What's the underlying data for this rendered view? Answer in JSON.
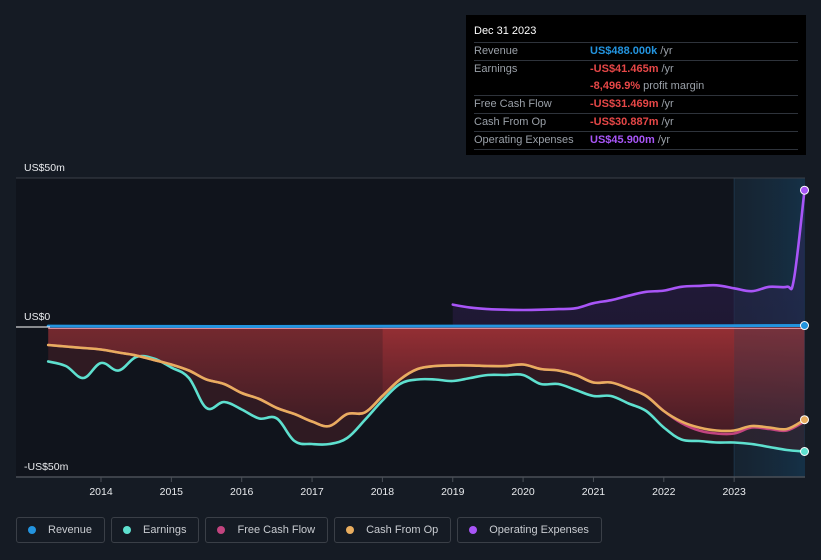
{
  "tooltip": {
    "date": "Dec 31 2023",
    "rows": [
      {
        "label": "Revenue",
        "value": "US$488.000k",
        "unit": "/yr",
        "color": "#2394df"
      },
      {
        "label": "Earnings",
        "value": "-US$41.465m",
        "unit": "/yr",
        "color": "#e64747"
      },
      {
        "label": "",
        "value": "-8,496.9%",
        "unit": "profit margin",
        "color": "#e64747"
      },
      {
        "label": "Free Cash Flow",
        "value": "-US$31.469m",
        "unit": "/yr",
        "color": "#e64747"
      },
      {
        "label": "Cash From Op",
        "value": "-US$30.887m",
        "unit": "/yr",
        "color": "#e64747"
      },
      {
        "label": "Operating Expenses",
        "value": "US$45.900m",
        "unit": "/yr",
        "color": "#a855f7"
      }
    ]
  },
  "legend": [
    {
      "label": "Revenue",
      "color": "#2394df"
    },
    {
      "label": "Earnings",
      "color": "#5ee0cf"
    },
    {
      "label": "Free Cash Flow",
      "color": "#c2447f"
    },
    {
      "label": "Cash From Op",
      "color": "#e8ad5f"
    },
    {
      "label": "Operating Expenses",
      "color": "#a855f7"
    }
  ],
  "chart_data": {
    "type": "line",
    "title": "",
    "xlabel": "",
    "ylabel": "",
    "ylim": [
      -50,
      50
    ],
    "xlim": [
      2013.25,
      2024.0
    ],
    "y_tick_labels": [
      {
        "value": 50,
        "label": "US$50m"
      },
      {
        "value": 0,
        "label": "US$0"
      },
      {
        "value": -50,
        "label": "-US$50m"
      }
    ],
    "x_tick_labels": [
      "2014",
      "2015",
      "2016",
      "2017",
      "2018",
      "2019",
      "2020",
      "2021",
      "2022",
      "2023"
    ],
    "forecast_region_start": 2023.0,
    "legend_position": "bottom",
    "grid": false,
    "series": [
      {
        "name": "Revenue",
        "color": "#2394df",
        "x": [
          2013.25,
          2015,
          2017,
          2019,
          2021,
          2023,
          2024.0
        ],
        "y": [
          0.3,
          0.2,
          0.2,
          0.3,
          0.3,
          0.4,
          0.49
        ]
      },
      {
        "name": "Earnings",
        "color": "#5ee0cf",
        "x": [
          2013.25,
          2013.5,
          2013.75,
          2014.0,
          2014.25,
          2014.5,
          2014.75,
          2015.0,
          2015.25,
          2015.5,
          2015.75,
          2016.0,
          2016.25,
          2016.5,
          2016.75,
          2017.0,
          2017.25,
          2017.5,
          2017.75,
          2018.0,
          2018.25,
          2018.5,
          2018.75,
          2019.0,
          2019.25,
          2019.5,
          2019.75,
          2020.0,
          2020.25,
          2020.5,
          2020.75,
          2021.0,
          2021.25,
          2021.5,
          2021.75,
          2022.0,
          2022.25,
          2022.5,
          2022.75,
          2023.0,
          2023.25,
          2023.5,
          2023.75,
          2024.0
        ],
        "y": [
          -11.5,
          -13,
          -17,
          -12,
          -14.5,
          -10,
          -10.5,
          -13.5,
          -17,
          -27,
          -25,
          -27.5,
          -30.5,
          -30.5,
          -38,
          -39,
          -39,
          -37,
          -31,
          -24.5,
          -19,
          -17.5,
          -17.5,
          -18,
          -17,
          -16,
          -16,
          -16,
          -19,
          -19,
          -21,
          -23,
          -23,
          -25.5,
          -28,
          -33.5,
          -37.5,
          -38,
          -38.5,
          -38.5,
          -39,
          -40,
          -41,
          -41.5
        ]
      },
      {
        "name": "Free Cash Flow",
        "color": "#c2447f",
        "x": [
          2013.25,
          2013.5,
          2013.75,
          2014.0,
          2014.25,
          2014.5,
          2014.75,
          2015.0,
          2015.25,
          2015.5,
          2015.75,
          2016.0,
          2016.25,
          2016.5,
          2016.75,
          2017.0,
          2017.25,
          2017.5,
          2017.75,
          2018.0,
          2018.25,
          2018.5,
          2018.75,
          2019.0,
          2019.25,
          2019.5,
          2019.75,
          2020.0,
          2020.25,
          2020.5,
          2020.75,
          2021.0,
          2021.25,
          2021.5,
          2021.75,
          2022.0,
          2022.25,
          2022.5,
          2022.75,
          2023.0,
          2023.25,
          2023.5,
          2023.75,
          2024.0
        ],
        "y": [
          -6,
          -6.5,
          -7,
          -7.5,
          -8.5,
          -9.5,
          -11,
          -12.5,
          -14.5,
          -17.5,
          -19,
          -22,
          -24,
          -27,
          -29,
          -31.5,
          -33,
          -29,
          -28.5,
          -23,
          -17.5,
          -14,
          -13,
          -12.8,
          -12.8,
          -13,
          -13,
          -12.5,
          -14,
          -14.5,
          -16,
          -18.5,
          -18.5,
          -20.5,
          -23,
          -28,
          -32,
          -34.5,
          -35.5,
          -35.5,
          -33.5,
          -34,
          -34.5,
          -31.5
        ]
      },
      {
        "name": "Cash From Op",
        "color": "#e8ad5f",
        "x": [
          2013.25,
          2013.5,
          2013.75,
          2014.0,
          2014.25,
          2014.5,
          2014.75,
          2015.0,
          2015.25,
          2015.5,
          2015.75,
          2016.0,
          2016.25,
          2016.5,
          2016.75,
          2017.0,
          2017.25,
          2017.5,
          2017.75,
          2018.0,
          2018.25,
          2018.5,
          2018.75,
          2019.0,
          2019.25,
          2019.5,
          2019.75,
          2020.0,
          2020.25,
          2020.5,
          2020.75,
          2021.0,
          2021.25,
          2021.5,
          2021.75,
          2022.0,
          2022.25,
          2022.5,
          2022.75,
          2023.0,
          2023.25,
          2023.5,
          2023.75,
          2024.0
        ],
        "y": [
          -6,
          -6.5,
          -7,
          -7.5,
          -8.5,
          -9.5,
          -11,
          -12.5,
          -14.5,
          -17.5,
          -19,
          -22,
          -24,
          -27,
          -29,
          -31.5,
          -33,
          -29,
          -28.5,
          -23,
          -17.5,
          -14,
          -13,
          -12.8,
          -12.8,
          -13,
          -13,
          -12.5,
          -14,
          -14.5,
          -16,
          -18.5,
          -18.5,
          -20.5,
          -23,
          -28,
          -31.5,
          -33.5,
          -34.5,
          -34.5,
          -33,
          -33.5,
          -34,
          -30.9
        ]
      },
      {
        "name": "Operating Expenses",
        "color": "#a855f7",
        "x": [
          2019.0,
          2019.25,
          2019.5,
          2019.75,
          2020.0,
          2020.25,
          2020.5,
          2020.75,
          2021.0,
          2021.25,
          2021.5,
          2021.75,
          2022.0,
          2022.25,
          2022.5,
          2022.75,
          2023.0,
          2023.25,
          2023.5,
          2023.75,
          2023.85,
          2024.0
        ],
        "y": [
          7.5,
          6.5,
          6,
          5.8,
          5.7,
          5.8,
          6,
          6.3,
          8,
          9,
          10.5,
          11.8,
          12.2,
          13.5,
          13.8,
          14,
          13,
          12,
          13.5,
          13.5,
          16,
          45.9
        ]
      }
    ]
  }
}
